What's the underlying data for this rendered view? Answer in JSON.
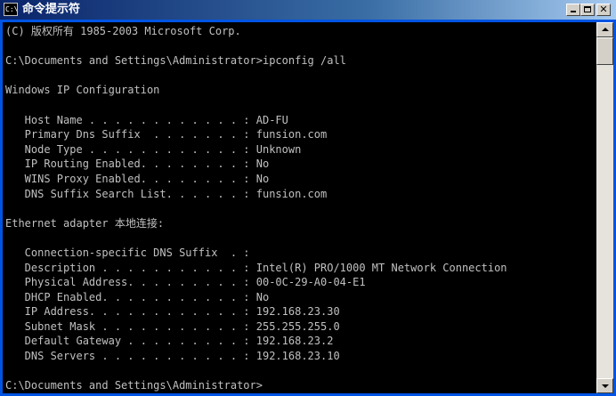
{
  "window": {
    "title": "命令提示符",
    "icon_text": "C:\\"
  },
  "console": {
    "lines": [
      "(C) 版权所有 1985-2003 Microsoft Corp.",
      "",
      "C:\\Documents and Settings\\Administrator>ipconfig /all",
      "",
      "Windows IP Configuration",
      "",
      "   Host Name . . . . . . . . . . . . : AD-FU",
      "   Primary Dns Suffix  . . . . . . . : funsion.com",
      "   Node Type . . . . . . . . . . . . : Unknown",
      "   IP Routing Enabled. . . . . . . . : No",
      "   WINS Proxy Enabled. . . . . . . . : No",
      "   DNS Suffix Search List. . . . . . : funsion.com",
      "",
      "Ethernet adapter 本地连接:",
      "",
      "   Connection-specific DNS Suffix  . :",
      "   Description . . . . . . . . . . . : Intel(R) PRO/1000 MT Network Connection",
      "   Physical Address. . . . . . . . . : 00-0C-29-A0-04-E1",
      "   DHCP Enabled. . . . . . . . . . . : No",
      "   IP Address. . . . . . . . . . . . : 192.168.23.30",
      "   Subnet Mask . . . . . . . . . . . : 255.255.255.0",
      "   Default Gateway . . . . . . . . . : 192.168.23.2",
      "   DNS Servers . . . . . . . . . . . : 192.168.23.10",
      "",
      "C:\\Documents and Settings\\Administrator>"
    ]
  },
  "colors": {
    "console_background": "#000000",
    "console_text": "#c0c0c0",
    "titlebar_start": "#0a246a",
    "titlebar_end": "#a6caf0"
  },
  "icons": {
    "window_icon": "cmd-icon",
    "minimize": "minimize-icon",
    "maximize": "maximize-icon",
    "close": "close-icon",
    "scroll_up": "arrow-up-icon",
    "scroll_down": "arrow-down-icon"
  }
}
